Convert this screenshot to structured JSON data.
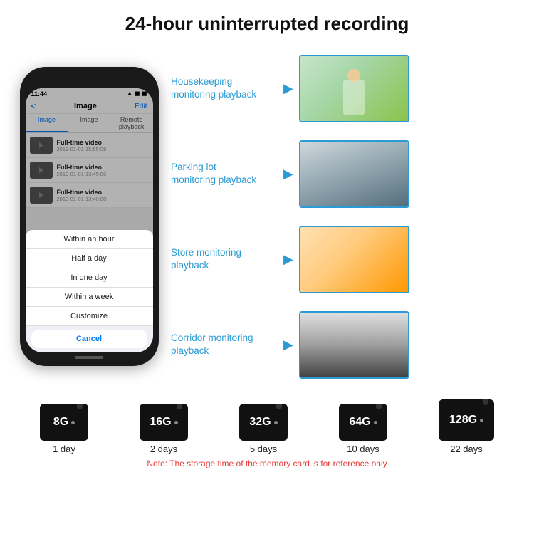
{
  "header": {
    "title": "24-hour uninterrupted recording"
  },
  "phone": {
    "time": "11:44",
    "screen_title": "Image",
    "edit_label": "Edit",
    "back_label": "<",
    "tabs": [
      "Image",
      "Image",
      "Remote playback"
    ],
    "videos": [
      {
        "name": "Full-time video",
        "date": "2019-01-01 15:55:08"
      },
      {
        "name": "Full-time video",
        "date": "2019-01-01 13:45:06"
      },
      {
        "name": "Full-time video",
        "date": "2019-01-01 13:40:08"
      }
    ],
    "dropdown_items": [
      "Within an hour",
      "Half a day",
      "In one day",
      "Within a week",
      "Customize"
    ],
    "cancel_label": "Cancel"
  },
  "monitoring": [
    {
      "label": "Housekeeping\nmonitoring playback",
      "photo_class": "photo-housekeeping"
    },
    {
      "label": "Parking lot\nmonitoring playback",
      "photo_class": "photo-parking"
    },
    {
      "label": "Store monitoring\nplayback",
      "photo_class": "photo-store"
    },
    {
      "label": "Corridor monitoring\nplayback",
      "photo_class": "photo-corridor"
    }
  ],
  "sd_cards": [
    {
      "size": "8G",
      "days": "1 day"
    },
    {
      "size": "16G",
      "days": "2 days"
    },
    {
      "size": "32G",
      "days": "5 days"
    },
    {
      "size": "64G",
      "days": "10 days"
    },
    {
      "size": "128G",
      "days": "22 days"
    }
  ],
  "note": "Note: The storage time of the memory card is for reference only"
}
